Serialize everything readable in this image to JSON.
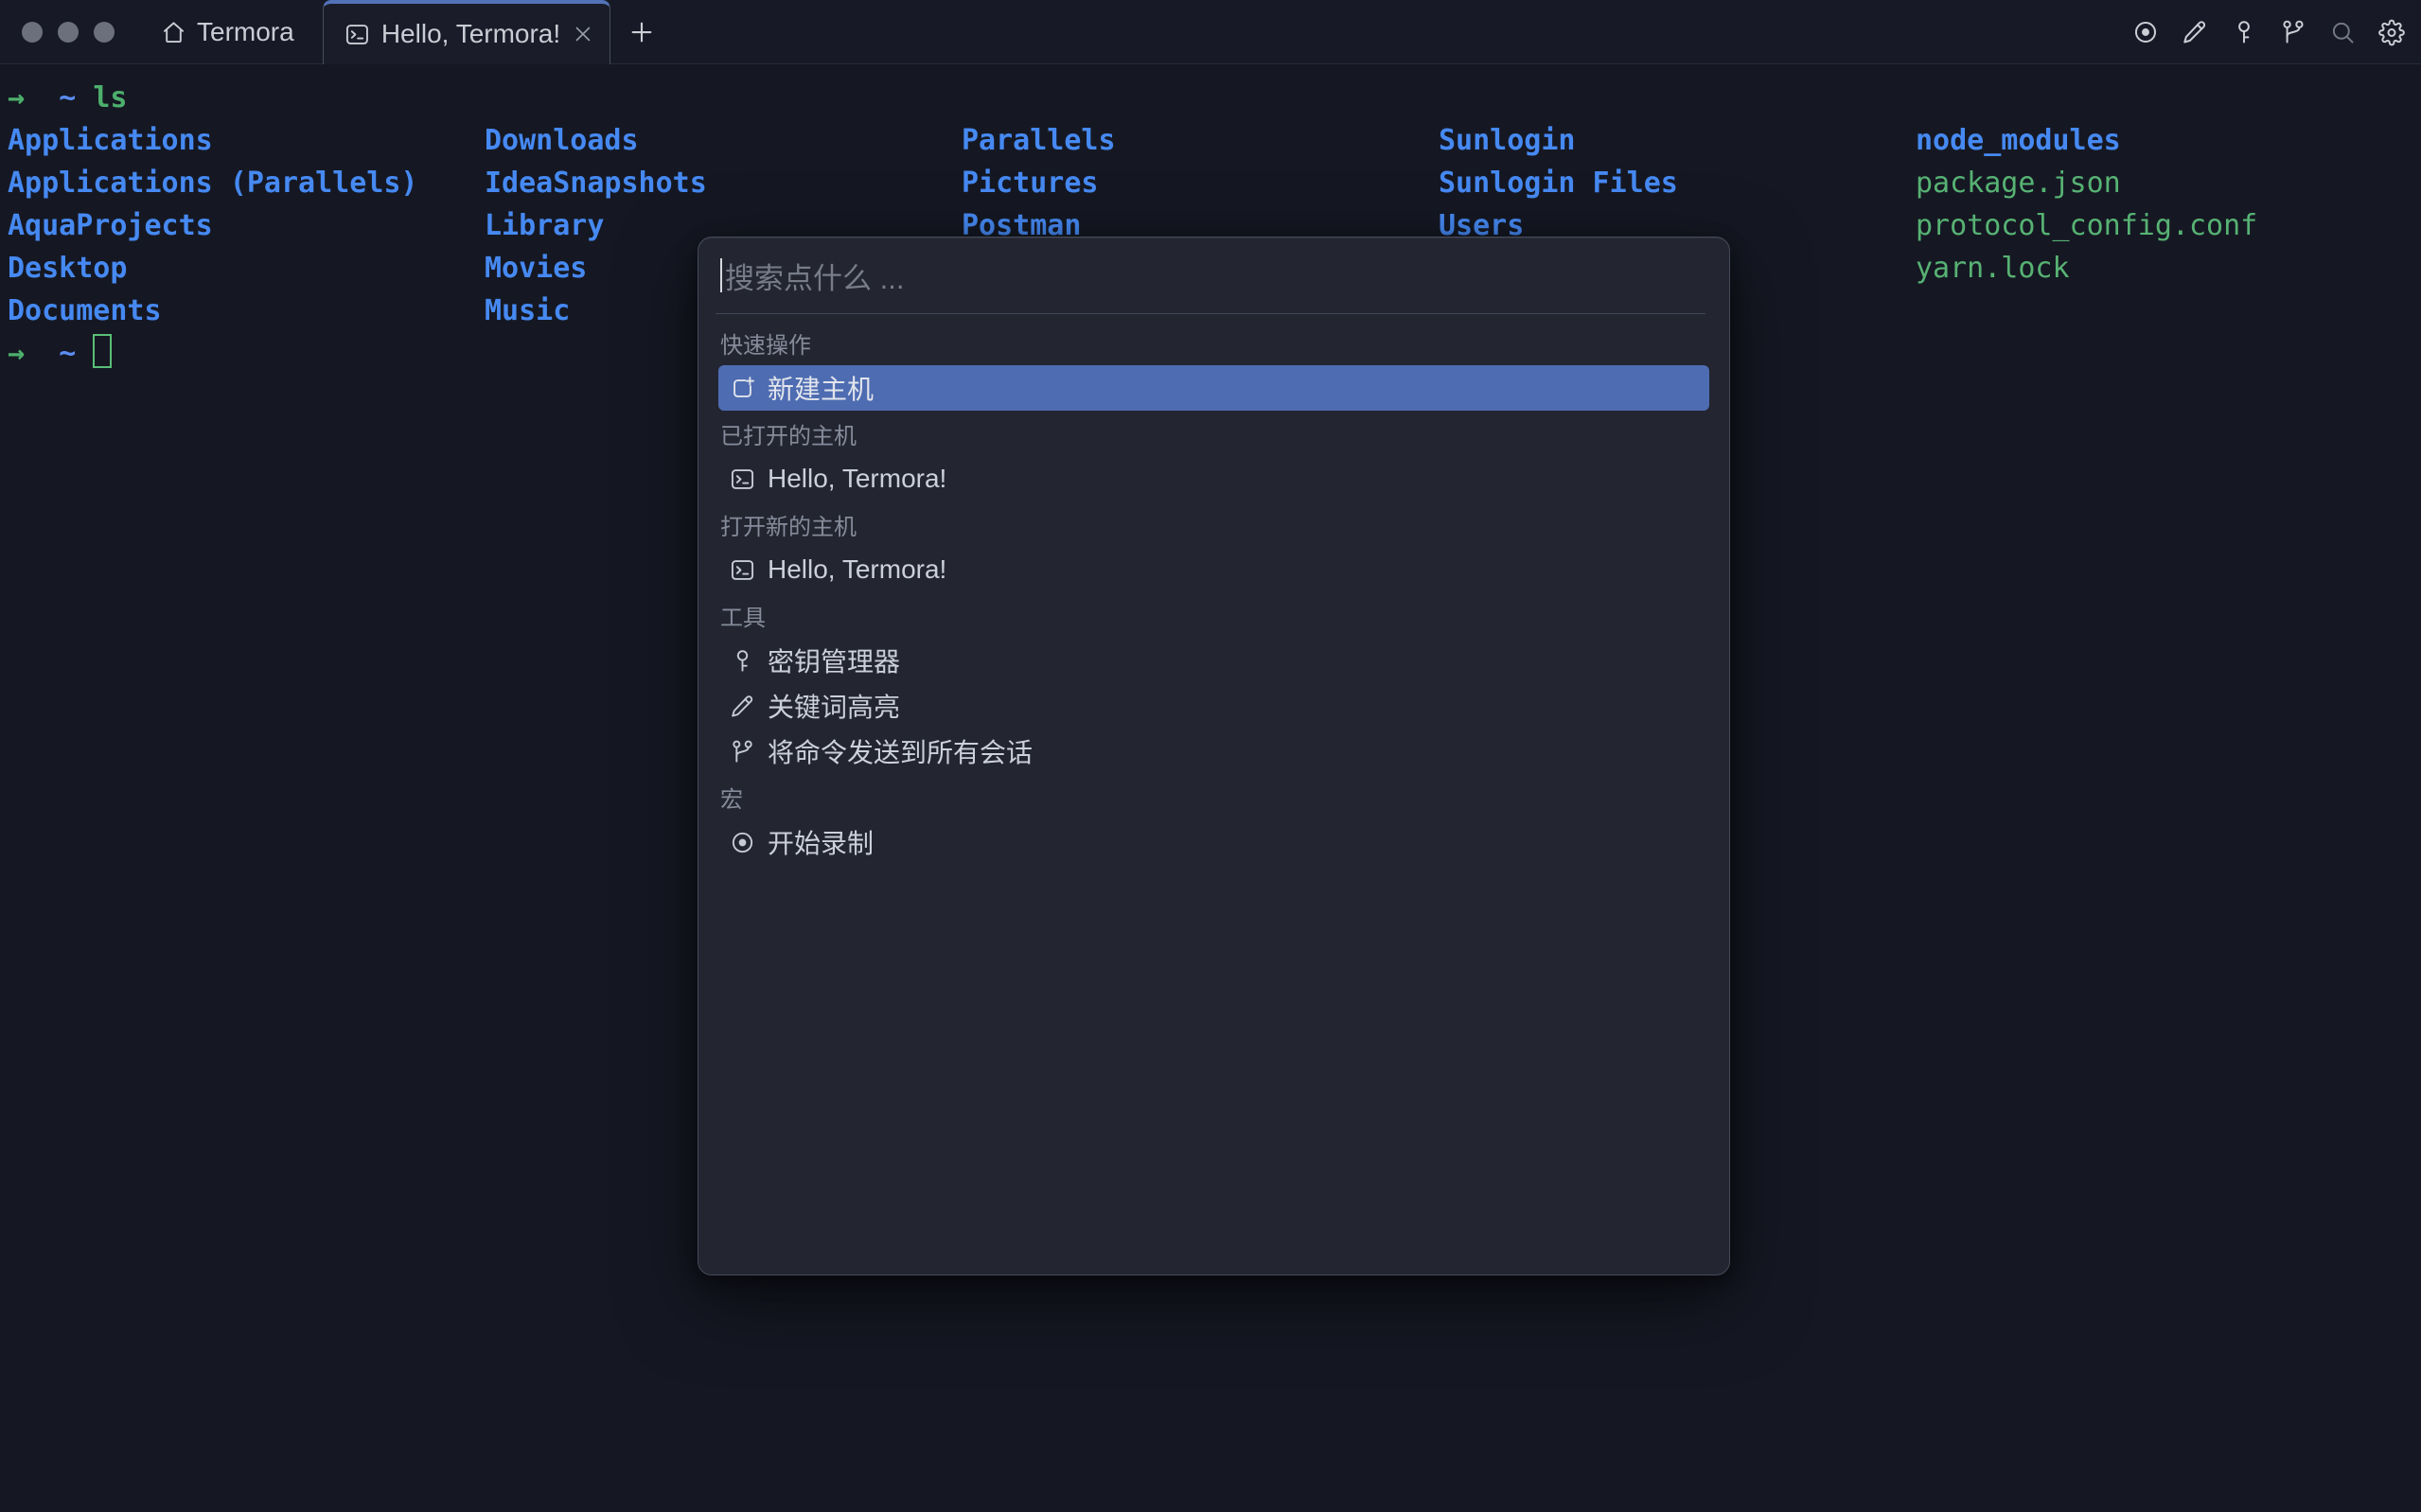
{
  "colors": {
    "bg": "#151823",
    "titlebar-bg": "#171a26",
    "tab-bg": "#1a1d29",
    "accent": "#5272b8",
    "dir-blue": "#4689f2",
    "file-green": "#57b273",
    "prompt-green": "#4daf6d",
    "path-blue": "#5b8ef3",
    "cursor-green": "#5abf77",
    "dlg-bg": "#232531",
    "sel-bg": "#4e6cb2"
  },
  "titlebar": {
    "home_label": "Termora",
    "tab_title": "Hello, Termora!",
    "toolbar_icons": [
      "record-icon",
      "edit-icon",
      "key-icon",
      "branch-icon",
      "search-icon",
      "settings-icon"
    ]
  },
  "terminal": {
    "prompt1": {
      "arrow": "→",
      "path": "~",
      "command": "ls"
    },
    "prompt2": {
      "arrow": "→",
      "path": "~"
    },
    "listing": {
      "columns": [
        {
          "entries": [
            {
              "name": "Applications",
              "type": "dir"
            },
            {
              "name": "Applications (Parallels)",
              "type": "dir"
            },
            {
              "name": "AquaProjects",
              "type": "dir"
            },
            {
              "name": "Desktop",
              "type": "dir"
            },
            {
              "name": "Documents",
              "type": "dir"
            }
          ]
        },
        {
          "entries": [
            {
              "name": "Downloads",
              "type": "dir"
            },
            {
              "name": "IdeaSnapshots",
              "type": "dir"
            },
            {
              "name": "Library",
              "type": "dir"
            },
            {
              "name": "Movies",
              "type": "dir"
            },
            {
              "name": "Music",
              "type": "dir"
            }
          ]
        },
        {
          "entries": [
            {
              "name": "Parallels",
              "type": "dir"
            },
            {
              "name": "Pictures",
              "type": "dir"
            },
            {
              "name": "Postman",
              "type": "dir"
            }
          ]
        },
        {
          "entries": [
            {
              "name": "Sunlogin",
              "type": "dir"
            },
            {
              "name": "Sunlogin Files",
              "type": "dir"
            },
            {
              "name": "Users",
              "type": "dir"
            }
          ]
        },
        {
          "entries": [
            {
              "name": "node_modules",
              "type": "dir"
            },
            {
              "name": "package.json",
              "type": "file"
            },
            {
              "name": "protocol_config.conf",
              "type": "file"
            },
            {
              "name": "yarn.lock",
              "type": "file"
            }
          ]
        }
      ]
    }
  },
  "palette": {
    "search_placeholder": "搜索点什么 ...",
    "sections": [
      {
        "label": "快速操作",
        "items": [
          {
            "icon": "new-host-icon",
            "label": "新建主机",
            "selected": true
          }
        ]
      },
      {
        "label": "已打开的主机",
        "items": [
          {
            "icon": "terminal-icon",
            "label": "Hello, Termora!",
            "selected": false
          }
        ]
      },
      {
        "label": "打开新的主机",
        "items": [
          {
            "icon": "terminal-icon",
            "label": "Hello, Termora!",
            "selected": false
          }
        ]
      },
      {
        "label": "工具",
        "items": [
          {
            "icon": "key-icon",
            "label": "密钥管理器",
            "selected": false
          },
          {
            "icon": "pencil-icon",
            "label": "关键词高亮",
            "selected": false
          },
          {
            "icon": "branch-icon",
            "label": "将命令发送到所有会话",
            "selected": false
          }
        ]
      },
      {
        "label": "宏",
        "items": [
          {
            "icon": "record-icon",
            "label": "开始录制",
            "selected": false
          }
        ]
      }
    ]
  }
}
